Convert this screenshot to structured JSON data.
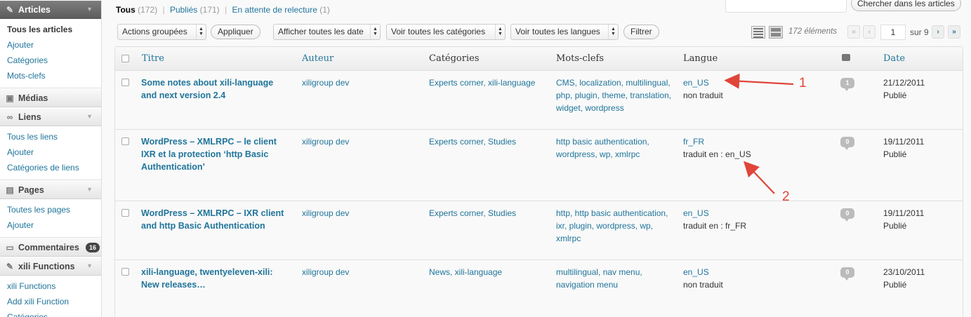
{
  "sidebar": {
    "articles": {
      "label": "Articles",
      "items": [
        "Tous les articles",
        "Ajouter",
        "Catégories",
        "Mots-clefs"
      ]
    },
    "medias": {
      "label": "Médias"
    },
    "liens": {
      "label": "Liens",
      "items": [
        "Tous les liens",
        "Ajouter",
        "Catégories de liens"
      ]
    },
    "pages": {
      "label": "Pages",
      "items": [
        "Toutes les pages",
        "Ajouter"
      ]
    },
    "commentaires": {
      "label": "Commentaires",
      "badge": "16"
    },
    "xili": {
      "label": "xili Functions",
      "items": [
        "xili Functions",
        "Add xili Function",
        "Catégories"
      ]
    }
  },
  "filters": {
    "all": "Tous",
    "all_count": "(172)",
    "published": "Publiés",
    "published_count": "(171)",
    "pending": "En attente de relecture",
    "pending_count": "(1)",
    "sep": "|"
  },
  "search": {
    "button": "Chercher dans les articles",
    "value": ""
  },
  "tablenav": {
    "bulk": "Actions groupées",
    "apply": "Appliquer",
    "dates": "Afficher toutes les date",
    "categories": "Voir toutes les catégories",
    "languages": "Voir toutes les langues",
    "filter": "Filtrer",
    "count": "172 éléments",
    "page": "1",
    "of_pages": "sur 9",
    "first": "«",
    "prev": "‹",
    "next": "›",
    "last": "»"
  },
  "columns": {
    "title": "Titre",
    "author": "Auteur",
    "categories": "Catégories",
    "tags": "Mots-clefs",
    "language": "Langue",
    "date": "Date"
  },
  "rows": [
    {
      "title_l1": "Some notes about xili-language",
      "title_l2": "and next version 2.4",
      "title_l3": "",
      "author": "xiligroup dev",
      "categories": "Experts corner, xili-language",
      "tags_l1": "CMS, localization, multilingual,",
      "tags_l2": "php, plugin, theme, translation,",
      "tags_l3": "widget, wordpress",
      "lang": "en_US",
      "lang_status": "non traduit",
      "comments": "1",
      "date": "21/12/2011",
      "status": "Publié"
    },
    {
      "title_l1": "WordPress – XMLRPC – le client",
      "title_l2": "IXR et la protection ‘http Basic",
      "title_l3": "Authentication’",
      "author": "xiligroup dev",
      "categories": "Experts corner, Studies",
      "tags_l1": "http basic authentication,",
      "tags_l2": "wordpress, wp, xmlrpc",
      "tags_l3": "",
      "lang": "fr_FR",
      "lang_status": "traduit en : en_US",
      "comments": "0",
      "date": "19/11/2011",
      "status": "Publié"
    },
    {
      "title_l1": "WordPress – XMLRPC – IXR client",
      "title_l2": "and http Basic Authentication",
      "title_l3": "",
      "author": "xiligroup dev",
      "categories": "Experts corner, Studies",
      "tags_l1": "http, http basic authentication,",
      "tags_l2": "ixr, plugin, wordpress, wp,",
      "tags_l3": "xmlrpc",
      "lang": "en_US",
      "lang_status": "traduit en : fr_FR",
      "comments": "0",
      "date": "19/11/2011",
      "status": "Publié"
    },
    {
      "title_l1": "xili-language, twentyeleven-xili:",
      "title_l2": "New releases…",
      "title_l3": "",
      "author": "xiligroup dev",
      "categories": "News, xili-language",
      "tags_l1": "multilingual, nav menu,",
      "tags_l2": "navigation menu",
      "tags_l3": "",
      "lang": "en_US",
      "lang_status": "non traduit",
      "comments": "0",
      "date": "23/10/2011",
      "status": "Publié"
    }
  ],
  "annotations": {
    "one": "1",
    "two": "2",
    "color": "#e0453a"
  }
}
